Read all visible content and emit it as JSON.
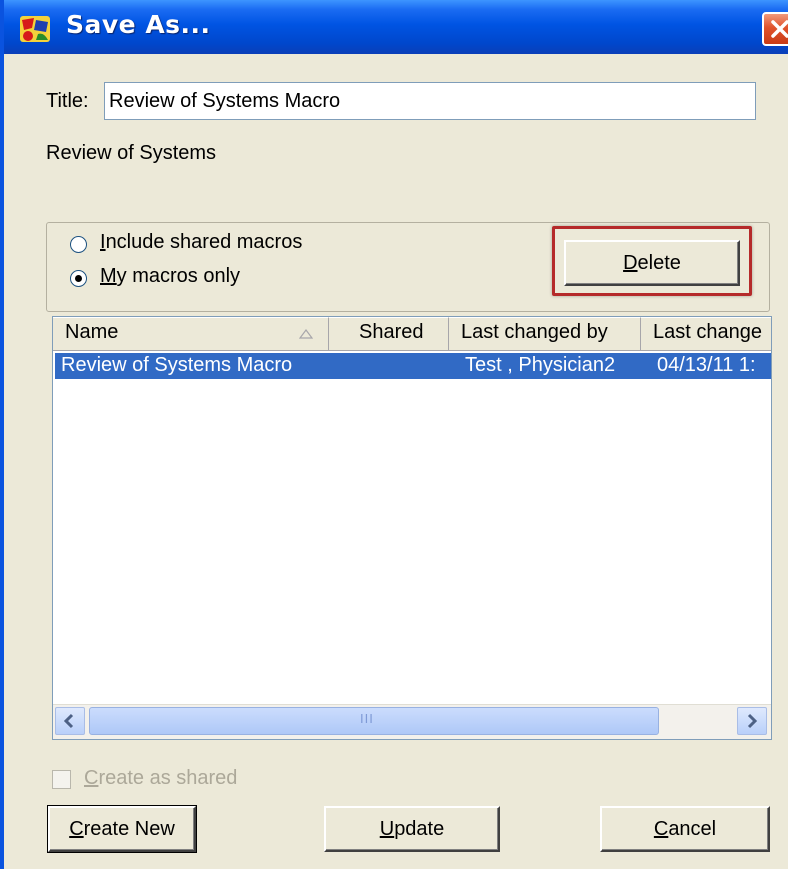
{
  "window": {
    "title": "Save As..."
  },
  "form": {
    "title_label": "Title:",
    "title_value": "Review of Systems Macro",
    "subtitle": "Review of Systems"
  },
  "filter": {
    "include_shared": {
      "mnemonic": "I",
      "rest": "nclude shared macros",
      "selected": false
    },
    "my_macros_only": {
      "mnemonic": "M",
      "rest": "y macros only",
      "selected": true
    }
  },
  "buttons": {
    "delete": {
      "mnemonic": "D",
      "rest": "elete"
    },
    "create_new": {
      "mnemonic": "C",
      "rest": "reate New"
    },
    "update": {
      "mnemonic": "U",
      "rest": "pdate"
    },
    "cancel": {
      "mnemonic": "C",
      "rest": "ancel"
    }
  },
  "list": {
    "columns": [
      "Name",
      "Shared",
      "Last changed by",
      "Last change"
    ],
    "rows": [
      {
        "name": "Review of Systems Macro",
        "shared": "",
        "last_changed_by": "Test , Physician2",
        "last_change": "04/13/11 1:"
      }
    ],
    "scroll_grip": "III"
  },
  "create_as_shared": {
    "mnemonic": "C",
    "rest": "reate as shared",
    "checked": false,
    "disabled": true
  },
  "colors": {
    "titlebar": "#0054e3",
    "selection": "#316ac5",
    "highlight_box": "#b52a2a"
  }
}
